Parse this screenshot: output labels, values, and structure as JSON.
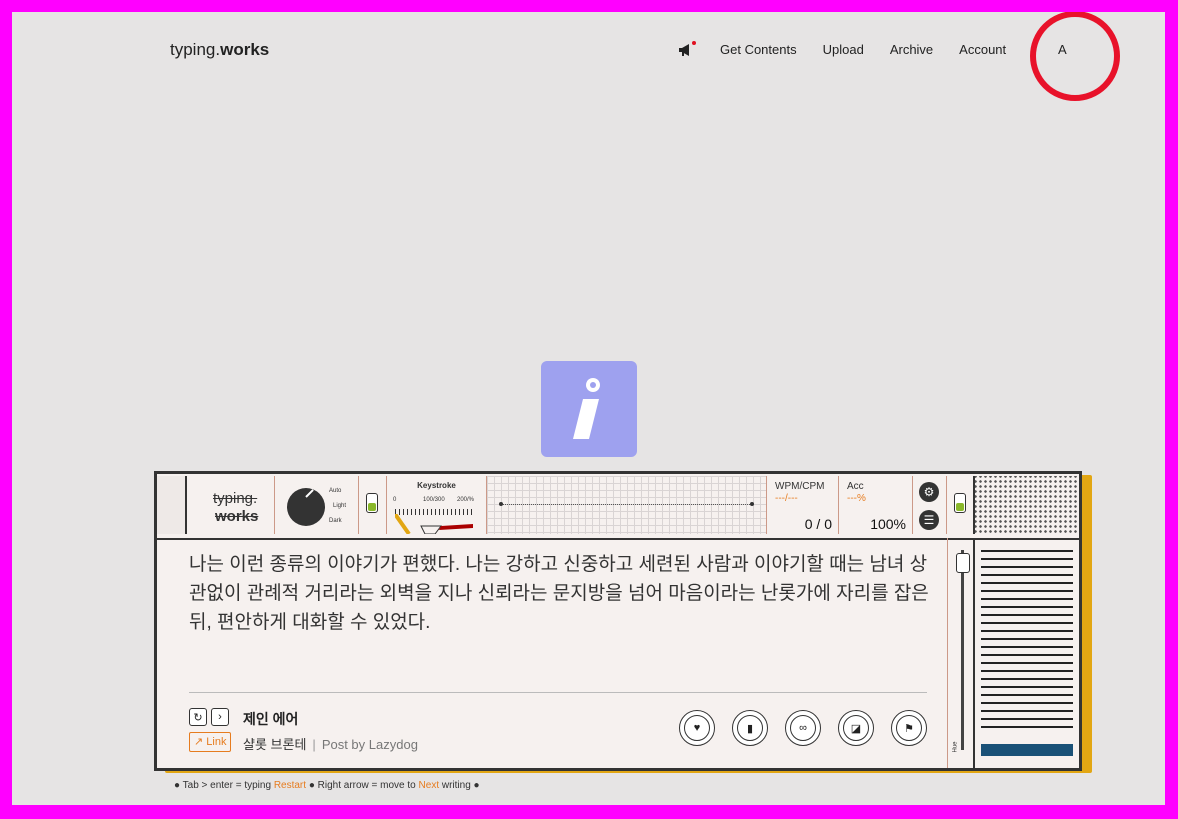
{
  "header": {
    "logo_light": "typing.",
    "logo_bold": "works",
    "nav": [
      "Get Contents",
      "Upload",
      "Archive",
      "Account"
    ],
    "avatar_label": "A"
  },
  "machine": {
    "logo_line1": "typing.",
    "logo_line2": "works",
    "theme_options": [
      "Auto",
      "Light",
      "Dark"
    ],
    "keystroke_title": "Keystroke",
    "keystroke_scale": [
      "0",
      "100/300",
      "200/%"
    ],
    "wpm_label": "WPM/CPM",
    "wpm_dash": "---/---",
    "wpm_value": "0 / 0",
    "acc_label": "Acc",
    "acc_dash": "---%",
    "acc_value": "100%",
    "hue_label": "Hue"
  },
  "content": {
    "text": "나는 이런 종류의 이야기가 편했다. 나는 강하고 신중하고 세련된 사람과 이야기할 때는 남녀 상관없이 관례적 거리라는 외벽을 지나 신뢰라는 문지방을 넘어 마음이라는 난롯가에 자리를 잡은 뒤, 편안하게 대화할 수 있었다.",
    "title": "제인 에어",
    "link_label": "Link",
    "author": "샬롯 브론테",
    "posted_by": "Post by Lazydog"
  },
  "hint": {
    "part1": "● Tab > enter = typing ",
    "restart": "Restart",
    "part2": " ● Right arrow = move to ",
    "next": "Next",
    "part3": " writing ●"
  },
  "colors": {
    "accent": "#e67c1f",
    "shadow": "#e2a613",
    "info_tile": "#9ea1ef",
    "bar": "#1a5177"
  }
}
